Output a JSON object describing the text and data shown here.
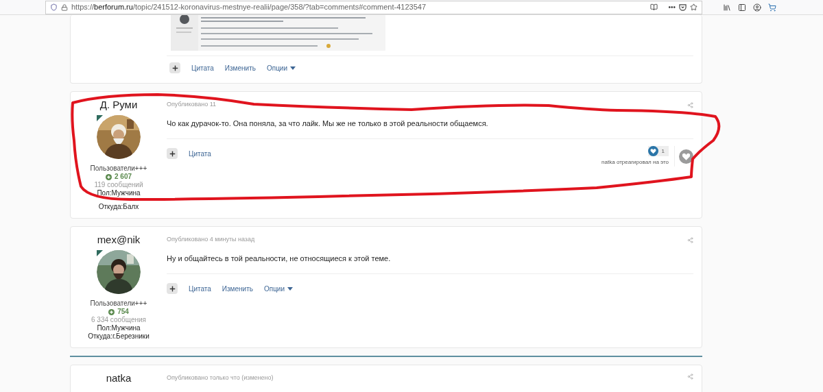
{
  "browser": {
    "url_prefix": "https://",
    "url_host": "berforum.ru",
    "url_path": "/topic/241512-koronavirus-mestnye-realii/page/358/?tab=comments#comment-4123547",
    "menu_dots": "•••"
  },
  "posts": [
    {
      "kind": "partial",
      "picture": {
        "kind": "picture"
      },
      "actions": [
        {
          "label": "Цитата",
          "dropdown": false
        },
        {
          "label": "Изменить",
          "dropdown": false
        },
        {
          "label": "Опции",
          "dropdown": true
        }
      ]
    },
    {
      "kind": "full",
      "highlighted": true,
      "author": "Д. Руми",
      "group": "Пользователи+++",
      "reputation": "2 607",
      "posts_count": "119 сообщений",
      "gender": "Пол:Мужчина",
      "location": "Откуда:Балх",
      "date": "Опубликовано 11",
      "text": "Чо как дурачок-то. Она поняла, за что лайк. Мы же не только в этой реальности общаемся.",
      "actions": [
        {
          "label": "Цитата",
          "dropdown": false
        }
      ],
      "reactions": {
        "count": "1",
        "summary": "natka отреагировал на это"
      }
    },
    {
      "kind": "full",
      "highlighted": false,
      "author": "mex@nik",
      "group": "Пользователи+++",
      "reputation": "754",
      "posts_count": "6 334 сообщения",
      "gender": "Пол:Мужчина",
      "location": "Откуда:г.Березники",
      "date": "Опубликовано 4 минуты назад",
      "text": "Ну и общайтесь в той реальности, не относящиеся к этой теме.",
      "actions": [
        {
          "label": "Цитата",
          "dropdown": false
        },
        {
          "label": "Изменить",
          "dropdown": false
        },
        {
          "label": "Опции",
          "dropdown": true
        }
      ]
    },
    {
      "kind": "cut",
      "unread_divider": true,
      "author": "natka",
      "date": "Опубликовано только что (изменено)"
    }
  ]
}
